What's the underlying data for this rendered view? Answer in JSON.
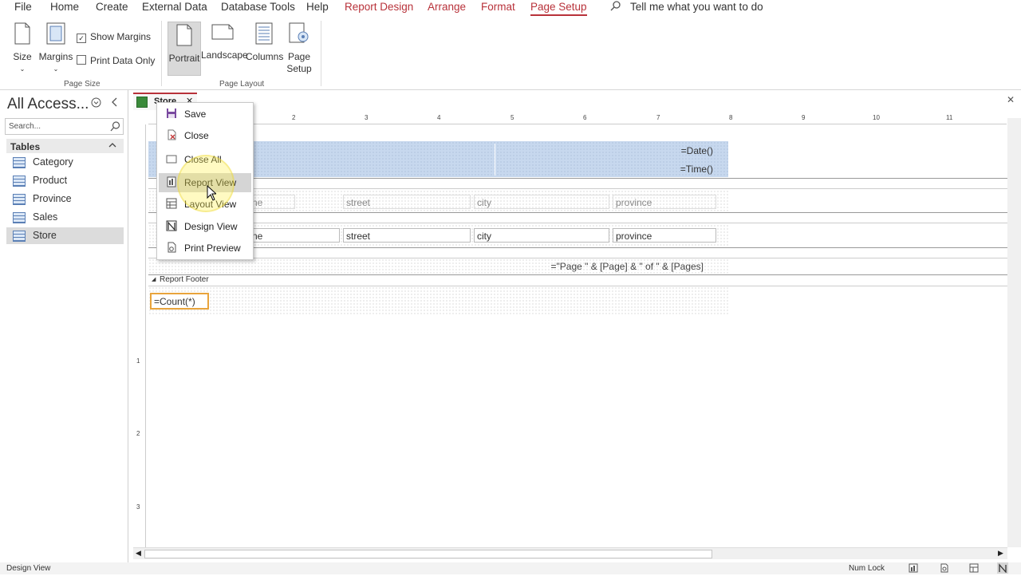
{
  "ribbon_tabs": [
    "File",
    "Home",
    "Create",
    "External Data",
    "Database Tools",
    "Help",
    "Report Design",
    "Arrange",
    "Format",
    "Page Setup"
  ],
  "tell_me": "Tell me what you want to do",
  "ribbon": {
    "size": "Size",
    "margins": "Margins",
    "show_margins": "Show Margins",
    "print_data_only": "Print Data Only",
    "page_size_group": "Page Size",
    "portrait": "Portrait",
    "landscape": "Landscape",
    "columns": "Columns",
    "page_setup_l1": "Page",
    "page_setup_l2": "Setup",
    "page_layout_group": "Page Layout"
  },
  "nav": {
    "title": "All Access...",
    "search_placeholder": "Search...",
    "section": "Tables",
    "items": [
      "Category",
      "Product",
      "Province",
      "Sales",
      "Store"
    ],
    "selected": "Store"
  },
  "doc_tab": "Store",
  "ruler_numbers": [
    "2",
    "3",
    "4",
    "5",
    "6",
    "7",
    "8",
    "9",
    "10",
    "11"
  ],
  "vruler_numbers": [
    "1",
    "2",
    "3"
  ],
  "report": {
    "date_expr": "=Date()",
    "time_expr": "=Time()",
    "page_header": [
      "ne",
      "street",
      "city",
      "province"
    ],
    "detail": [
      "ne",
      "street",
      "city",
      "province"
    ],
    "page_footer_expr": "=\"Page \" & [Page] & \" of \" & [Pages]",
    "report_footer": "Report Footer",
    "count_expr": "=Count(*)"
  },
  "context_menu": [
    "Save",
    "Close",
    "Close All",
    "Report View",
    "Layout View",
    "Design View",
    "Print Preview"
  ],
  "status": {
    "left": "Design View",
    "num_lock": "Num Lock"
  },
  "colors": {
    "accent": "#b8323a",
    "selection_blue": "#c7d8ee"
  }
}
